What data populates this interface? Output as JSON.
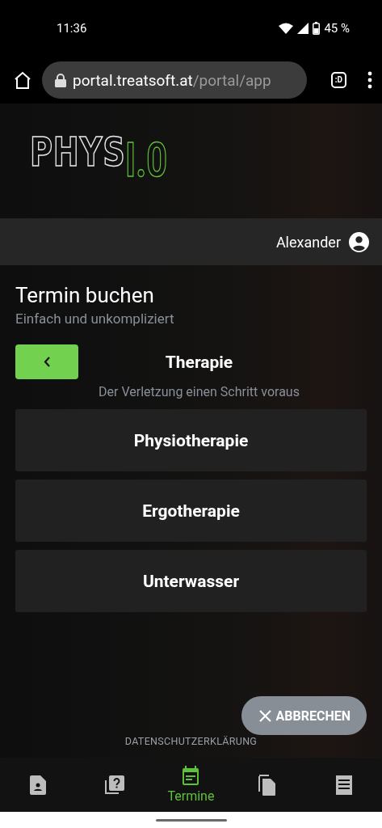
{
  "status_bar": {
    "time": "11:36",
    "battery": "45 %"
  },
  "browser": {
    "url_host": "portal.treatsoft.at",
    "url_path": "/portal/app",
    "tab_badge": ":D"
  },
  "logo": {
    "main": "PHYS",
    "accent": "I.0"
  },
  "user": {
    "name": "Alexander"
  },
  "page": {
    "title": "Termin buchen",
    "subtitle": "Einfach und unkompliziert"
  },
  "step": {
    "title": "Therapie",
    "subtitle": "Der Verletzung einen Schritt voraus"
  },
  "options": [
    {
      "label": "Physiotherapie"
    },
    {
      "label": "Ergotherapie"
    },
    {
      "label": "Unterwasser"
    }
  ],
  "cancel_button": "ABBRECHEN",
  "footer_link": "DATENSCHUTZERKLÄRUNG",
  "bottom_nav": [
    {
      "kind": "contact",
      "selected": false
    },
    {
      "kind": "questions",
      "selected": false
    },
    {
      "kind": "calendar",
      "selected": true,
      "label": "Termine"
    },
    {
      "kind": "documents",
      "selected": false
    },
    {
      "kind": "receipt",
      "selected": false
    }
  ]
}
